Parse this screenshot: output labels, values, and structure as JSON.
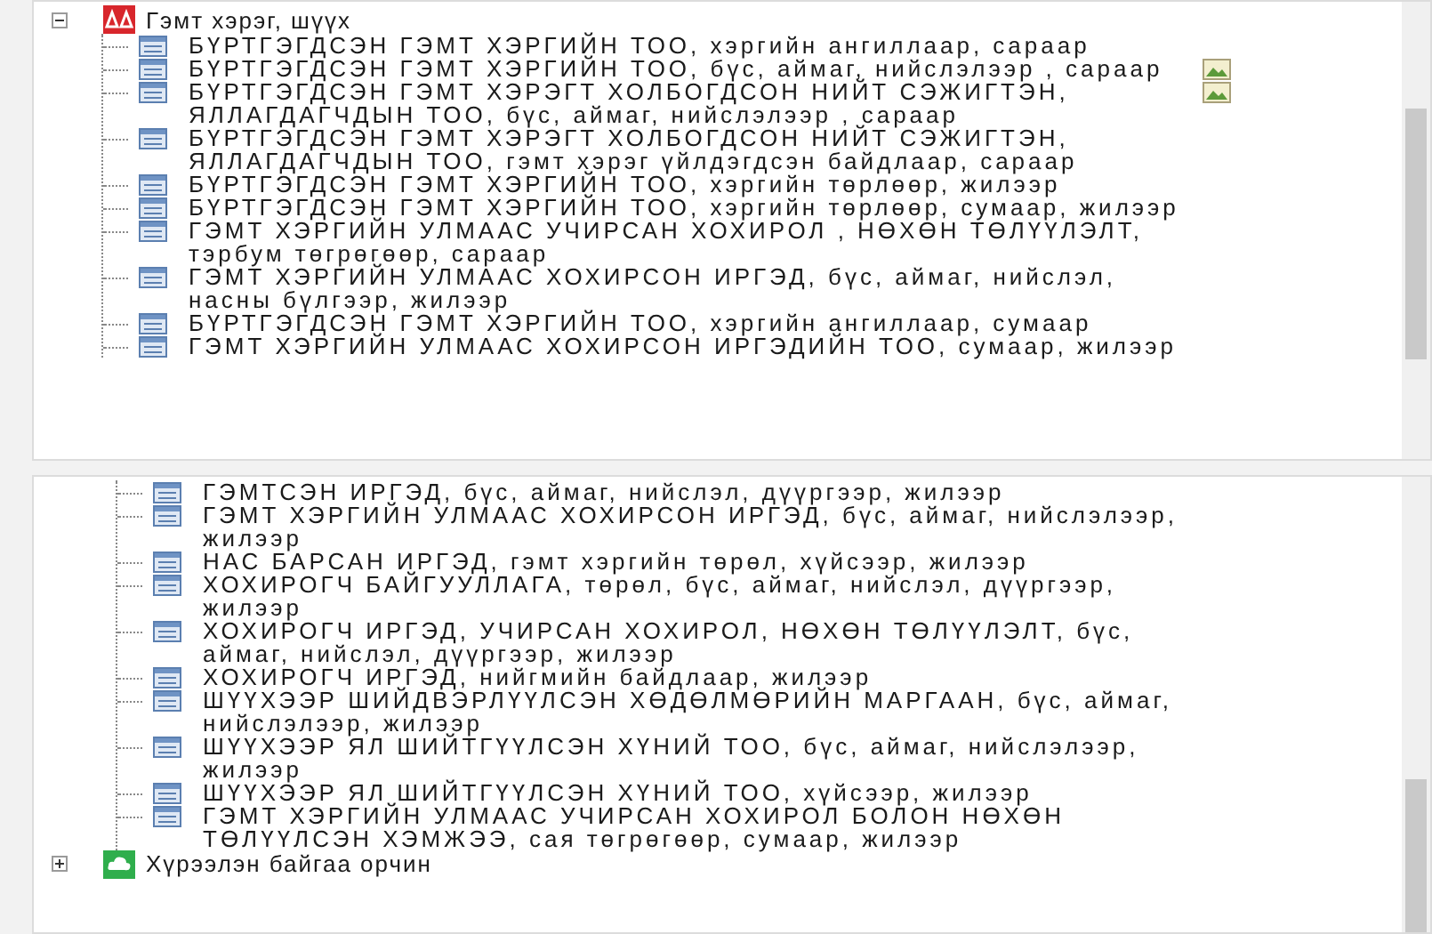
{
  "panels": [
    {
      "nodes": [
        {
          "kind": "alert-folder",
          "label": "Гэмт хэрэг, шүүх",
          "expanded": true,
          "children": [
            {
              "label": "БҮРТГЭГДСЭН ГЭМТ ХЭРГИЙН ТОО, хэргийн ангиллаар, сараар",
              "has_image": false
            },
            {
              "label": "БҮРТГЭГДСЭН ГЭМТ ХЭРГИЙН ТОО, бүс, аймаг, нийслэлээр , сараар",
              "has_image": true
            },
            {
              "label": "БҮРТГЭГДСЭН ГЭМТ ХЭРЭГТ ХОЛБОГДСОН НИЙТ СЭЖИГТЭН, ЯЛЛАГДАГЧДЫН ТОО, бүс, аймаг, нийслэлээр , сараар",
              "has_image": true
            },
            {
              "label": "БҮРТГЭГДСЭН ГЭМТ ХЭРЭГТ ХОЛБОГДСОН НИЙТ СЭЖИГТЭН, ЯЛЛАГДАГЧДЫН ТОО, гэмт хэрэг үйлдэгдсэн байдлаар, сараар",
              "has_image": false
            },
            {
              "label": "БҮРТГЭГДСЭН ГЭМТ ХЭРГИЙН ТОО, хэргийн төрлөөр, жилээр",
              "has_image": false
            },
            {
              "label": "БҮРТГЭГДСЭН ГЭМТ ХЭРГИЙН ТОО, хэргийн төрлөөр, сумаар, жилээр",
              "has_image": false
            },
            {
              "label": "ГЭМТ ХЭРГИЙН УЛМААС УЧИРСАН ХОХИРОЛ , НӨХӨН ТӨЛҮҮЛЭЛТ, тэрбум төгрөгөөр, сараар",
              "has_image": false
            },
            {
              "label": "ГЭМТ ХЭРГИЙН УЛМААС ХОХИРСОН ИРГЭД, бүс, аймаг, нийслэл, насны бүлгээр, жилээр",
              "has_image": false
            },
            {
              "label": "БҮРТГЭГДСЭН ГЭМТ ХЭРГИЙН ТОО, хэргийн ангиллаар, сумаар",
              "has_image": false
            },
            {
              "label": "ГЭМТ ХЭРГИЙН УЛМААС ХОХИРСОН ИРГЭДИЙН ТОО, сумаар, жилээр",
              "has_image": false
            }
          ]
        }
      ]
    },
    {
      "nodes": [
        {
          "kind": "continuation",
          "children": [
            {
              "label": "ГЭМТСЭН ИРГЭД, бүс, аймаг, нийслэл, дүүргээр, жилээр",
              "has_image": false
            },
            {
              "label": "ГЭМТ ХЭРГИЙН УЛМААС ХОХИРСОН ИРГЭД, бүс, аймаг, нийслэлээр, жилээр",
              "has_image": false
            },
            {
              "label": "НАС БАРСАН ИРГЭД, гэмт хэргийн төрөл, хүйсээр, жилээр",
              "has_image": false
            },
            {
              "label": "ХОХИРОГЧ БАЙГУУЛЛАГА, төрөл, бүс, аймаг, нийслэл, дүүргээр, жилээр",
              "has_image": false
            },
            {
              "label": "ХОХИРОГЧ ИРГЭД, УЧИРСАН ХОХИРОЛ, НӨХӨН ТӨЛҮҮЛЭЛТ, бүс, аймаг, нийслэл, дүүргээр, жилээр",
              "has_image": false
            },
            {
              "label": "ХОХИРОГЧ ИРГЭД, нийгмийн байдлаар, жилээр",
              "has_image": false
            },
            {
              "label": "ШҮҮХЭЭР ШИЙДВЭРЛҮҮЛСЭН ХӨДӨЛМӨРИЙН МАРГААН, бүс, аймаг, нийслэлээр, жилээр",
              "has_image": false
            },
            {
              "label": "ШҮҮХЭЭР ЯЛ ШИЙТГҮҮЛСЭН ХҮНИЙ ТОО, бүс, аймаг, нийслэлээр, жилээр",
              "has_image": false
            },
            {
              "label": "ШҮҮХЭЭР ЯЛ ШИЙТГҮҮЛСЭН ХҮНИЙ ТОО, хүйсээр, жилээр",
              "has_image": false
            },
            {
              "label": "ГЭМТ ХЭРГИЙН УЛМААС УЧИРСАН ХОХИРОЛ БОЛОН НӨХӨН ТӨЛҮҮЛСЭН ХЭМЖЭЭ, сая төгрөгөөр, сумаар, жилээр",
              "has_image": false
            }
          ]
        },
        {
          "kind": "nature-folder",
          "label": "Хүрээлэн байгаа орчин",
          "expanded": false
        }
      ]
    }
  ]
}
